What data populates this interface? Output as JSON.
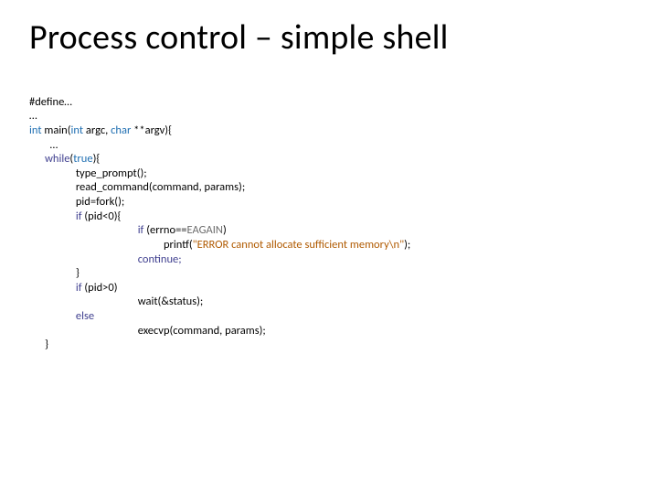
{
  "title": "Process control – simple shell",
  "code": {
    "l01": "#define…",
    "l02": "…",
    "l03a": "int",
    "l03b": " main(",
    "l03c": "int",
    "l03d": " argc, ",
    "l03e": "char",
    "l03f": " **argv){",
    "l04": "        …",
    "l05a": "      while",
    "l05b": "(",
    "l05c": "true",
    "l05d": "){",
    "l06": "                  type_prompt();",
    "l07": "                  read_command(command, params);",
    "l08": "                  pid=fork();",
    "l09a": "                  if",
    "l09b": " (pid<0){",
    "l10a": "                                          if",
    "l10b": " (errno==",
    "l10c": "EAGAIN",
    "l10d": ")",
    "l11a": "                                                    printf(",
    "l11b": "\"ERROR cannot allocate sufficient memory\\n\"",
    "l11c": ");",
    "l12": "                                          continue;",
    "l13": "                  }",
    "l14a": "                  if",
    "l14b": " (pid>0)",
    "l15": "                                          wait(&status);",
    "l16": "                  else",
    "l17": "                                          execvp(command, params);",
    "l18": "      }"
  }
}
